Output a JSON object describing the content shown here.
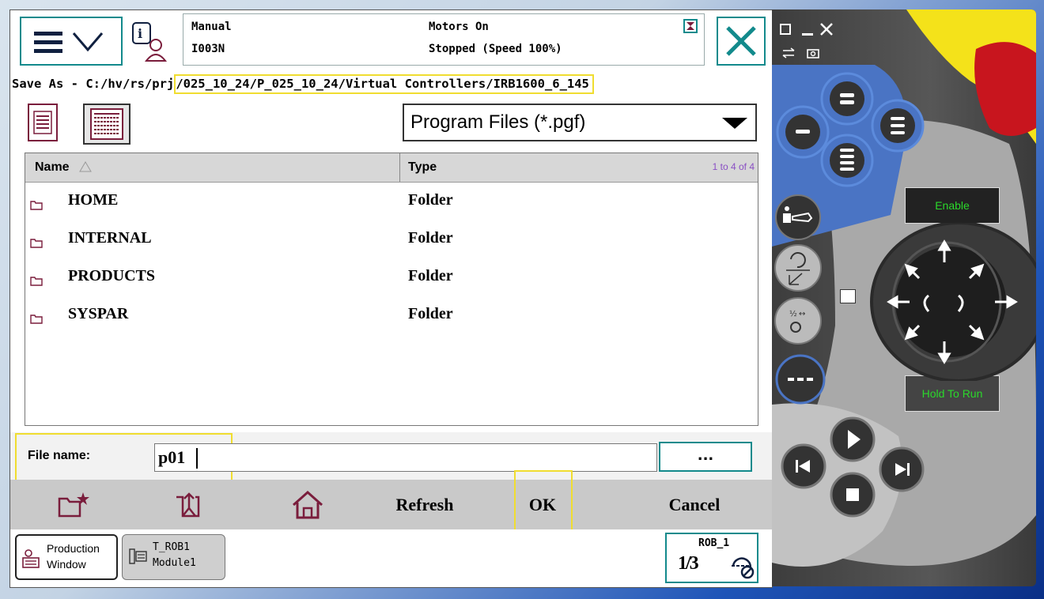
{
  "header": {
    "mode": "Manual",
    "controller": "I003N",
    "motors": "Motors On",
    "state": "Stopped (Speed 100%)"
  },
  "path": {
    "prefix": "Save As - C:/hv/rs/prj",
    "rest": "/025_10_24/P_025_10_24/Virtual Controllers/IRB1600_6_145"
  },
  "filter": {
    "selected": "Program Files (*.pgf)"
  },
  "list": {
    "col_name": "Name",
    "col_type": "Type",
    "count": "1 to 4 of 4",
    "rows": [
      {
        "name": "HOME",
        "type": "Folder"
      },
      {
        "name": "INTERNAL",
        "type": "Folder"
      },
      {
        "name": "PRODUCTS",
        "type": "Folder"
      },
      {
        "name": "SYSPAR",
        "type": "Folder"
      }
    ]
  },
  "filename": {
    "label": "File name:",
    "value": "p01",
    "browse_label": "..."
  },
  "toolbar": {
    "refresh": "Refresh",
    "ok": "OK",
    "cancel": "Cancel"
  },
  "taskbar": {
    "production_line1": "Production",
    "production_line2": "Window",
    "trob_line1": "T_ROB1",
    "trob_line2": "Module1",
    "rob_label": "ROB_1",
    "rob_fraction": "1/3"
  },
  "pendant": {
    "enable_label": "Enable",
    "hold_label": "Hold To Run"
  },
  "colors": {
    "teal": "#128a8c",
    "maroon": "#7a1d3c",
    "highlight": "#f0dd30",
    "pendant_blue": "#4a74c4"
  }
}
